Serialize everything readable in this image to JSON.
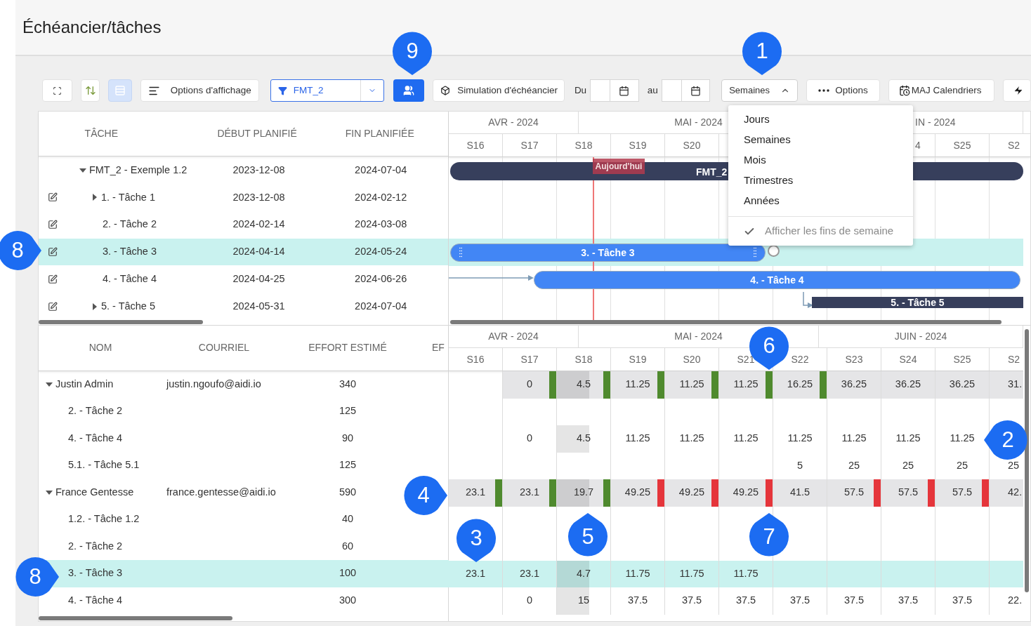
{
  "header": {
    "title": "Échéancier/tâches"
  },
  "toolbar": {
    "view_toggle": {
      "selected": true
    },
    "display_options": "Options d'affichage",
    "filter": {
      "value": "FMT_2"
    },
    "simulation": "Simulation d'échéancier",
    "from_label": "Du",
    "to_label": "au",
    "scale": {
      "value": "Semaines",
      "open": true
    },
    "options": "Options",
    "update_calendars": "MAJ Calendriers"
  },
  "scale_menu": {
    "items": [
      "Jours",
      "Semaines",
      "Mois",
      "Trimestres",
      "Années"
    ],
    "weekend_option": {
      "label": "Afficher les fins de semaine",
      "checked": true
    }
  },
  "task_table": {
    "columns": [
      "TÂCHE",
      "DÉBUT PLANIFIÉ",
      "FIN PLANIFIÉE"
    ],
    "rows": [
      {
        "task": "FMT_2 - Exemple 1.2",
        "start": "2023-12-08",
        "end": "2024-07-04",
        "editable": false,
        "selected": false,
        "expanded": true,
        "bar": {
          "label": "FMT_2",
          "kind": "project"
        },
        "children": [
          {
            "task": "1. - Tâche 1",
            "start": "2023-12-08",
            "end": "2024-02-12",
            "editable": true,
            "selected": false,
            "expanded": false
          },
          {
            "task": "2. - Tâche 2",
            "start": "2024-02-14",
            "end": "2024-03-08",
            "editable": true,
            "selected": false
          },
          {
            "task": "3. - Tâche 3",
            "start": "2024-04-14",
            "end": "2024-05-24",
            "editable": true,
            "selected": true,
            "bar": {
              "label": "3. - Tâche 3",
              "kind": "task"
            }
          },
          {
            "task": "4. - Tâche 4",
            "start": "2024-04-25",
            "end": "2024-06-26",
            "editable": true,
            "selected": false,
            "bar": {
              "label": "4. - Tâche 4",
              "kind": "task"
            }
          },
          {
            "task": "5. - Tâche 5",
            "start": "2024-05-31",
            "end": "2024-07-04",
            "editable": true,
            "selected": false,
            "expanded": false,
            "bar": {
              "label": "5. - Tâche 5",
              "kind": "summary"
            }
          }
        ]
      }
    ]
  },
  "task_timeline": {
    "months": [
      "AVR - 2024",
      "MAI - 2024",
      "IN - 2024"
    ],
    "weeks": [
      "S16",
      "S17",
      "S18",
      "S19",
      "S20",
      "4",
      "S25",
      "S2"
    ],
    "today_label": "Aujourd'hui"
  },
  "resource_table": {
    "columns": [
      "NOM",
      "COURRIEL",
      "EFFORT ESTIMÉ",
      "EF"
    ],
    "rows": [
      {
        "name": "Justin Admin",
        "email": "justin.ngoufo@aidi.io",
        "effort": "340",
        "expanded": true,
        "selected": false,
        "cells": [
          null,
          {
            "value": "0",
            "color": "#4f8a2e"
          },
          {
            "value": "4.5",
            "color": "#4f8a2e"
          },
          {
            "value": "11.25",
            "color": "#4f8a2e"
          },
          {
            "value": "11.25",
            "color": "#4f8a2e"
          },
          {
            "value": "11.25",
            "color": "#4f8a2e"
          },
          {
            "value": "16.25",
            "color": "#4f8a2e"
          },
          {
            "value": "36.25"
          },
          {
            "value": "36.25"
          },
          {
            "value": "36.25"
          },
          {
            "value": "31."
          }
        ],
        "children": [
          {
            "name": "2. - Tâche 2",
            "effort": "125",
            "selected": false
          },
          {
            "name": "4. - Tâche 4",
            "effort": "90",
            "selected": false,
            "cells": [
              null,
              {
                "value": "0"
              },
              {
                "value": "4.5"
              },
              {
                "value": "11.25"
              },
              {
                "value": "11.25"
              },
              {
                "value": "11.25"
              },
              {
                "value": "11.25"
              },
              {
                "value": "11.25"
              },
              {
                "value": "11.25"
              },
              {
                "value": "11.25"
              },
              null
            ]
          },
          {
            "name": "5.1. - Tâche 5.1",
            "effort": "125",
            "selected": false,
            "cells": [
              null,
              null,
              null,
              null,
              null,
              null,
              {
                "value": "5"
              },
              {
                "value": "25"
              },
              {
                "value": "25"
              },
              {
                "value": "25"
              },
              {
                "value": "25"
              }
            ]
          }
        ]
      },
      {
        "name": "France Gentesse",
        "email": "france.gentesse@aidi.io",
        "effort": "590",
        "expanded": true,
        "selected": false,
        "cells": [
          {
            "value": "23.1",
            "color": "#4f8a2e"
          },
          {
            "value": "23.1",
            "color": "#4f8a2e"
          },
          {
            "value": "19.7",
            "color": "#4f8a2e"
          },
          {
            "value": "49.25",
            "color": "#e5353b"
          },
          {
            "value": "49.25",
            "color": "#e5353b"
          },
          {
            "value": "49.25",
            "color": "#e5353b"
          },
          {
            "value": "41.5"
          },
          {
            "value": "57.5",
            "color": "#e5353b"
          },
          {
            "value": "57.5",
            "color": "#e5353b"
          },
          {
            "value": "57.5",
            "color": "#e5353b"
          },
          {
            "value": "42."
          }
        ],
        "children": [
          {
            "name": "1.2. - Tâche 1.2",
            "effort": "40",
            "selected": false
          },
          {
            "name": "2. - Tâche 2",
            "effort": "60",
            "selected": false
          },
          {
            "name": "3. - Tâche 3",
            "effort": "100",
            "selected": true,
            "cells": [
              {
                "value": "23.1"
              },
              {
                "value": "23.1"
              },
              {
                "value": "4.7"
              },
              {
                "value": "11.75"
              },
              {
                "value": "11.75"
              },
              {
                "value": "11.75"
              }
            ]
          },
          {
            "name": "4. - Tâche 4",
            "effort": "300",
            "selected": false,
            "cells": [
              null,
              {
                "value": "0"
              },
              {
                "value": "15"
              },
              {
                "value": "37.5"
              },
              {
                "value": "37.5"
              },
              {
                "value": "37.5"
              },
              {
                "value": "37.5"
              },
              {
                "value": "37.5"
              },
              {
                "value": "37.5"
              },
              {
                "value": "37.5"
              },
              {
                "value": "22."
              }
            ]
          }
        ]
      }
    ]
  },
  "resource_timeline": {
    "months": [
      "AVR - 2024",
      "MAI - 2024",
      "JUIN - 2024"
    ],
    "weeks": [
      "S16",
      "S17",
      "S18",
      "S19",
      "S20",
      "S21",
      "S22",
      "S23",
      "S24",
      "S25",
      "S2"
    ]
  },
  "callouts": [
    {
      "number": "9"
    },
    {
      "number": "1"
    },
    {
      "number": "8"
    },
    {
      "number": "6"
    },
    {
      "number": "2"
    },
    {
      "number": "4"
    },
    {
      "number": "3"
    },
    {
      "number": "5"
    },
    {
      "number": "7"
    },
    {
      "number": "8"
    }
  ]
}
